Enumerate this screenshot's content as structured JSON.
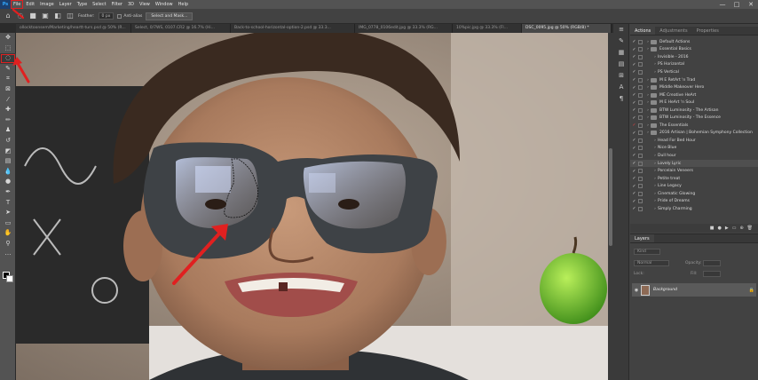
{
  "menu": {
    "logo": "Ps",
    "items": [
      "File",
      "Edit",
      "Image",
      "Layer",
      "Type",
      "Select",
      "Filter",
      "3D",
      "View",
      "Window",
      "Help"
    ],
    "window_controls": [
      "—",
      "□",
      "✕"
    ]
  },
  "options": {
    "feather_label": "Feather:",
    "feather_value": "0 px",
    "antialias_label": "Anti-alias",
    "select_mask_label": "Select and Mask..."
  },
  "tabs": [
    "ollocktoonsem/Marketing/heartt-turs.psd @ 50% (R...",
    "Select, 0/7WS, 0107.CR2 @ 16.7% (Hi...",
    "Back-to-school-horizontal-option-2.psd @ 33.3...",
    "IMG_0778_0106edit.jpg @ 33.3% (RG...",
    "10%pic.jpg @ 33.3% (Fl...",
    "DSC_0095.jpg @ 50% (RGB/8) *"
  ],
  "active_tab_index": 5,
  "panels": {
    "tabs": [
      "Actions",
      "Adjustments",
      "Properties"
    ],
    "active_tab": 0,
    "actions": [
      {
        "label": "Default Actions",
        "type": "set",
        "red": false
      },
      {
        "label": "Essential Basics",
        "type": "set",
        "red": false
      },
      {
        "label": "Invisible - 2016",
        "type": "action",
        "red": false
      },
      {
        "label": "PS Horizontal",
        "type": "action",
        "red": false
      },
      {
        "label": "PS Vertical",
        "type": "action",
        "red": false
      },
      {
        "label": "M E RetArt 'n Trad",
        "type": "set",
        "red": false
      },
      {
        "label": "Middle Makeover Hero",
        "type": "set",
        "red": false
      },
      {
        "label": "ME Creative HeArt",
        "type": "set",
        "red": false
      },
      {
        "label": "M E HeArt 'n Soul",
        "type": "set",
        "red": false
      },
      {
        "label": "BTW Luminosity - The Artisan",
        "type": "set",
        "red": false
      },
      {
        "label": "BTW Luminosity - The Essence",
        "type": "set",
        "red": false
      },
      {
        "label": "The Essentials",
        "type": "set",
        "red": true
      },
      {
        "label": "2016 Artisan | Bohemian Symphony Collection",
        "type": "set",
        "red": false
      },
      {
        "label": "Head For Bed Hour",
        "type": "action",
        "red": false
      },
      {
        "label": "Nice Blue",
        "type": "action",
        "red": false
      },
      {
        "label": "Dull hour",
        "type": "action",
        "red": false
      },
      {
        "label": "Lovely Lyric",
        "type": "action",
        "red": false
      },
      {
        "label": "Porcelain Veneers",
        "type": "action",
        "red": false
      },
      {
        "label": "Petite treat",
        "type": "action",
        "red": false
      },
      {
        "label": "Line Legacy",
        "type": "action",
        "red": false
      },
      {
        "label": "Cinematic Glowing",
        "type": "action",
        "red": false
      },
      {
        "label": "Pride of Dreams",
        "type": "action",
        "red": false
      },
      {
        "label": "Simply Charming",
        "type": "action",
        "red": false
      }
    ]
  },
  "layers": {
    "tab": "Layers",
    "kind_label": "Kind",
    "mode_label": "Normal",
    "opacity_label": "Opacity:",
    "lock_label": "Lock:",
    "fill_label": "Fill:",
    "layer_name": "Background"
  }
}
